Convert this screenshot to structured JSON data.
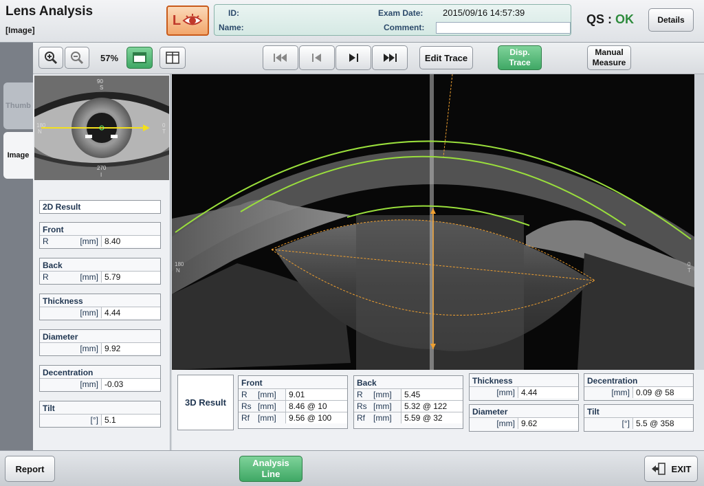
{
  "header": {
    "title": "Lens Analysis",
    "subtitle": "[Image]",
    "eye_letter": "L",
    "id_label": "ID:",
    "name_label": "Name:",
    "exam_date_label": "Exam Date:",
    "exam_date_value": "2015/09/16 14:57:39",
    "comment_label": "Comment:",
    "qs_label": "QS :",
    "qs_value": "OK",
    "details_label": "Details"
  },
  "tabs": {
    "thumb": "Thumb",
    "image": "Image"
  },
  "toolbar": {
    "zoom_level": "57%",
    "edit_trace": "Edit Trace",
    "disp_trace": "Disp. Trace",
    "manual_measure": "Manual Measure"
  },
  "thumbnail": {
    "top": "90",
    "top_letter": "S",
    "left": "180",
    "left_letter": "N",
    "right": "0",
    "right_letter": "T",
    "bottom": "270",
    "bottom_letter": "I"
  },
  "oct_labels": {
    "left": "180",
    "left_letter": "N",
    "right": "0",
    "right_letter": "T"
  },
  "result2d": {
    "heading": "2D Result",
    "front": {
      "title": "Front",
      "param": "R",
      "unit": "[mm]",
      "value": "8.40"
    },
    "back": {
      "title": "Back",
      "param": "R",
      "unit": "[mm]",
      "value": "5.79"
    },
    "thickness": {
      "title": "Thickness",
      "unit": "[mm]",
      "value": "4.44"
    },
    "diameter": {
      "title": "Diameter",
      "unit": "[mm]",
      "value": "9.92"
    },
    "decentration": {
      "title": "Decentration",
      "unit": "[mm]",
      "value": "-0.03"
    },
    "tilt": {
      "title": "Tilt",
      "unit": "[°]",
      "value": "5.1"
    }
  },
  "result3d": {
    "heading": "3D Result",
    "front": {
      "title": "Front",
      "rows": [
        {
          "param": "R",
          "unit": "[mm]",
          "value": "9.01"
        },
        {
          "param": "Rs",
          "unit": "[mm]",
          "value": "8.46 @ 10"
        },
        {
          "param": "Rf",
          "unit": "[mm]",
          "value": "9.56 @ 100"
        }
      ]
    },
    "back": {
      "title": "Back",
      "rows": [
        {
          "param": "R",
          "unit": "[mm]",
          "value": "5.45"
        },
        {
          "param": "Rs",
          "unit": "[mm]",
          "value": "5.32 @ 122"
        },
        {
          "param": "Rf",
          "unit": "[mm]",
          "value": "5.59 @ 32"
        }
      ]
    },
    "thickness": {
      "title": "Thickness",
      "unit": "[mm]",
      "value": "4.44"
    },
    "diameter": {
      "title": "Diameter",
      "unit": "[mm]",
      "value": "9.62"
    },
    "decentration": {
      "title": "Decentration",
      "unit": "[mm]",
      "value": "0.09 @ 58"
    },
    "tilt": {
      "title": "Tilt",
      "unit": "[°]",
      "value": "5.5 @ 358"
    }
  },
  "footer": {
    "report": "Report",
    "analysis_line": "Analysis Line",
    "exit": "EXIT"
  },
  "colors": {
    "accent_green": "#3fa865",
    "trace_green": "#9adf3c",
    "guide_orange": "#f0a030",
    "eye_orange": "#f2a66b"
  }
}
